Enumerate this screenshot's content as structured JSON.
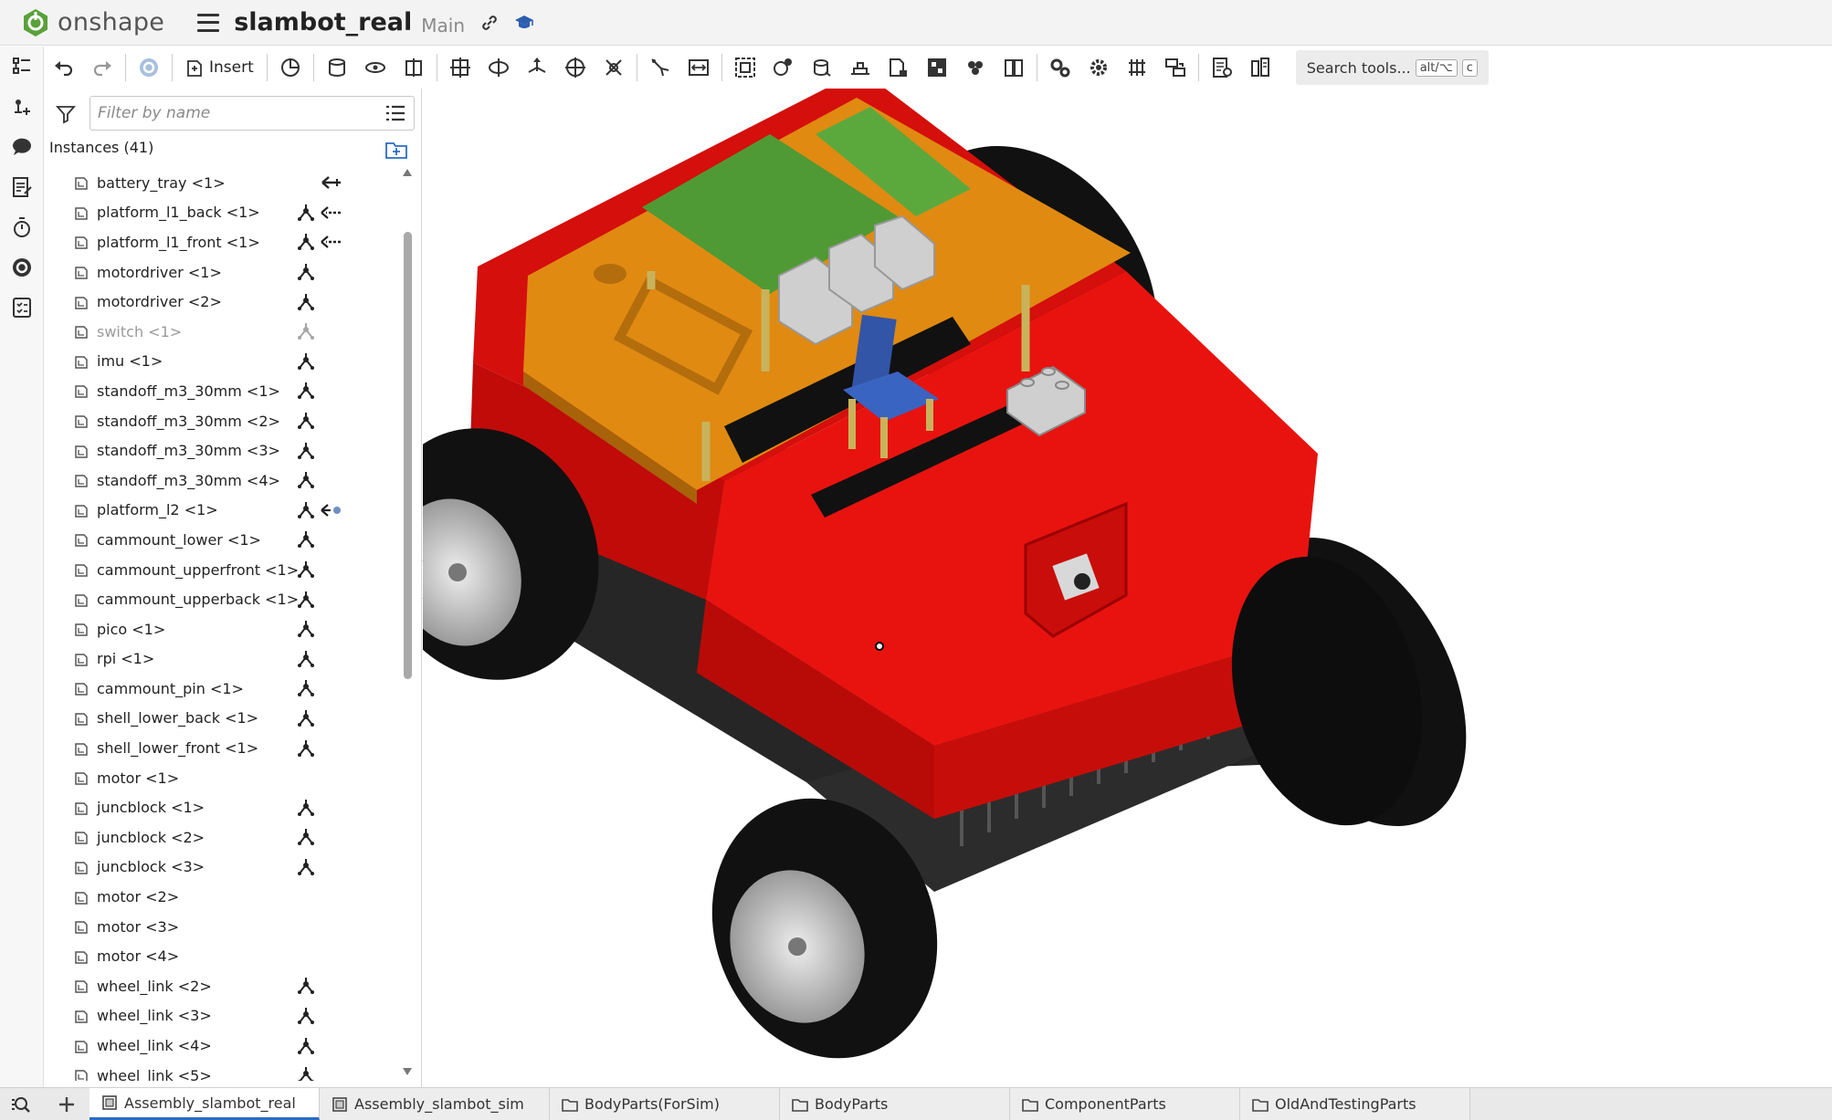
{
  "header": {
    "brand": "onshape",
    "document_title": "slambot_real",
    "branch": "Main"
  },
  "toolbar": {
    "insert_label": "Insert",
    "search_label": "Search tools...",
    "shortcut_1": "alt/⌥",
    "shortcut_2": "c"
  },
  "panel": {
    "filter_placeholder": "Filter by name",
    "instances_header": "Instances (41)",
    "items": [
      {
        "name": "battery_tray <1>",
        "mate": false,
        "extra": "arrow"
      },
      {
        "name": "platform_l1_back <1>",
        "mate": true,
        "extra": "dash-arrow"
      },
      {
        "name": "platform_l1_front <1>",
        "mate": true,
        "extra": "dash-arrow"
      },
      {
        "name": "motordriver <1>",
        "mate": true
      },
      {
        "name": "motordriver <2>",
        "mate": true
      },
      {
        "name": "switch <1>",
        "mate": true,
        "muted": true
      },
      {
        "name": "imu <1>",
        "mate": true
      },
      {
        "name": "standoff_m3_30mm <1>",
        "mate": true
      },
      {
        "name": "standoff_m3_30mm <2>",
        "mate": true
      },
      {
        "name": "standoff_m3_30mm <3>",
        "mate": true
      },
      {
        "name": "standoff_m3_30mm <4>",
        "mate": true
      },
      {
        "name": "platform_l2 <1>",
        "mate": true,
        "extra": "arrow-dot"
      },
      {
        "name": "cammount_lower <1>",
        "mate": true
      },
      {
        "name": "cammount_upperfront <1>",
        "mate": true
      },
      {
        "name": "cammount_upperback <1>",
        "mate": true
      },
      {
        "name": "pico <1>",
        "mate": true
      },
      {
        "name": "rpi <1>",
        "mate": true
      },
      {
        "name": "cammount_pin <1>",
        "mate": true
      },
      {
        "name": "shell_lower_back <1>",
        "mate": true
      },
      {
        "name": "shell_lower_front <1>",
        "mate": true
      },
      {
        "name": "motor <1>",
        "mate": false
      },
      {
        "name": "juncblock <1>",
        "mate": true
      },
      {
        "name": "juncblock <2>",
        "mate": true
      },
      {
        "name": "juncblock <3>",
        "mate": true
      },
      {
        "name": "motor <2>",
        "mate": false
      },
      {
        "name": "motor <3>",
        "mate": false
      },
      {
        "name": "motor <4>",
        "mate": false
      },
      {
        "name": "wheel_link <2>",
        "mate": true
      },
      {
        "name": "wheel_link <3>",
        "mate": true
      },
      {
        "name": "wheel_link <4>",
        "mate": true
      },
      {
        "name": "wheel_link <5>",
        "mate": true
      }
    ]
  },
  "tabs": [
    {
      "label": "Assembly_slambot_real",
      "icon": "assembly-icon",
      "active": true
    },
    {
      "label": "Assembly_slambot_sim",
      "icon": "assembly-icon",
      "active": false
    },
    {
      "label": "BodyParts(ForSim)",
      "icon": "folder-icon",
      "active": false
    },
    {
      "label": "BodyParts",
      "icon": "folder-icon",
      "active": false
    },
    {
      "label": "ComponentParts",
      "icon": "folder-icon",
      "active": false
    },
    {
      "label": "OldAndTestingParts",
      "icon": "folder-icon",
      "active": false
    }
  ],
  "colors": {
    "brand_green": "#5aa13b",
    "shell_red": "#e8130f",
    "platform_orange": "#e08a12",
    "board_green": "#4f9a34",
    "active_tab": "#2b6cc4"
  }
}
